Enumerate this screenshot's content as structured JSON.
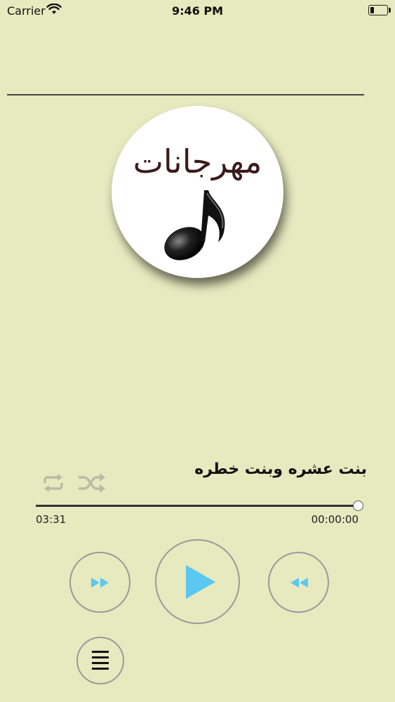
{
  "status_bar": {
    "carrier": "Carrier",
    "time": "9:46 PM",
    "icons": [
      "wifi-icon",
      "battery-icon"
    ]
  },
  "logo": {
    "text": "مهرجانات",
    "icon": "music-note-icon"
  },
  "player": {
    "track_title": "بنت عشره وبنت خطره",
    "elapsed": "00:00:00",
    "duration": "03:31",
    "progress": 1.0,
    "controls": [
      "repeat-icon",
      "shuffle-icon",
      "fast-forward-icon",
      "play-icon",
      "rewind-icon",
      "playlist-icon"
    ]
  },
  "colors": {
    "background": "#e7e9bf",
    "accent": "#5ac8f0",
    "control_disabled": "#b9bca6"
  }
}
